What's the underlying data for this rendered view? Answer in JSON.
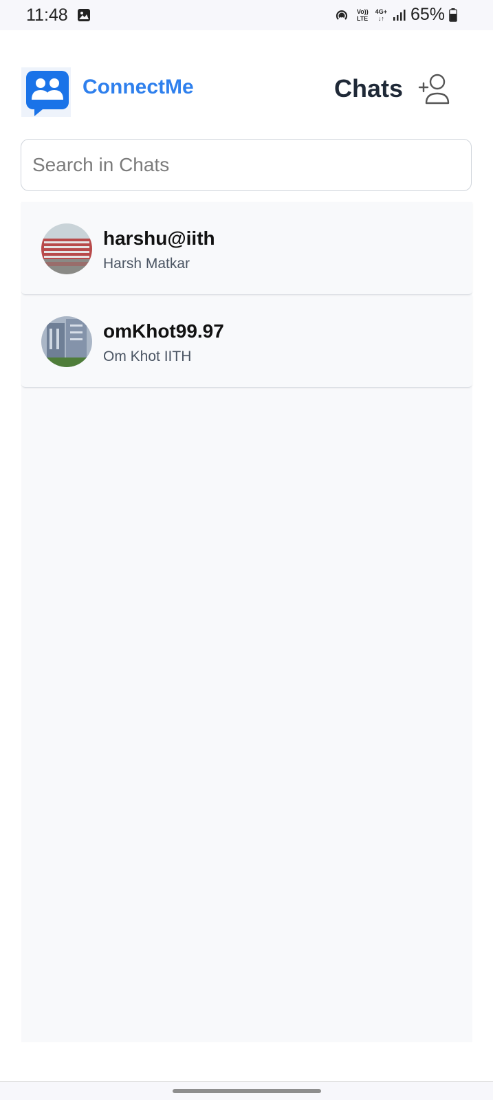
{
  "status_bar": {
    "time": "11:48",
    "volte_top": "Vo))",
    "volte_bottom": "LTE",
    "network_top": "4G+",
    "network_bottom": "↓↑",
    "battery_percent": "65%",
    "icons": [
      "gallery-icon",
      "hotspot-icon",
      "signal-icon",
      "battery-icon"
    ]
  },
  "header": {
    "app_name": "ConnectMe",
    "title": "Chats",
    "logo_icon": "people-chat-icon",
    "action_icon": "add-user-icon"
  },
  "search": {
    "placeholder": "Search in Chats",
    "value": ""
  },
  "chats": [
    {
      "username": "harshu@iith",
      "name": "Harsh Matkar"
    },
    {
      "username": "omKhot99.97",
      "name": "Om Khot IITH"
    }
  ],
  "colors": {
    "brand": "#2f80ed",
    "title": "#1f2937",
    "list_background": "#f8f9fb",
    "status_bar": "#f7f7fb"
  }
}
